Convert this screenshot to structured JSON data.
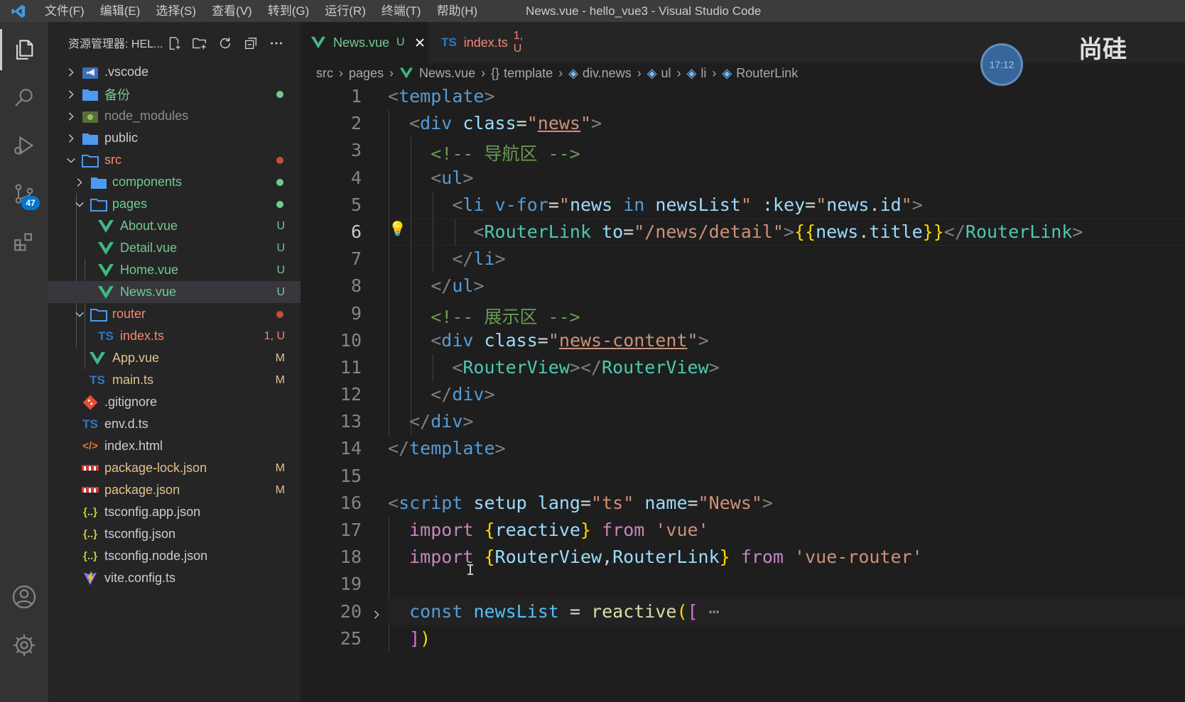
{
  "app": {
    "window_title": "News.vue - hello_vue3 - Visual Studio Code",
    "menu": [
      "文件(F)",
      "编辑(E)",
      "选择(S)",
      "查看(V)",
      "转到(G)",
      "运行(R)",
      "终端(T)",
      "帮助(H)"
    ]
  },
  "activity_bar": {
    "source_control_badge": "47"
  },
  "explorer": {
    "title": "资源管理器: HEL...",
    "items": [
      {
        "name": ".vscode",
        "type": "folder",
        "status": ""
      },
      {
        "name": "备份",
        "type": "folder",
        "status": ""
      },
      {
        "name": "node_modules",
        "type": "folder",
        "status": ""
      },
      {
        "name": "public",
        "type": "folder",
        "status": ""
      },
      {
        "name": "src",
        "type": "folder",
        "status": ""
      },
      {
        "name": "components",
        "type": "folder",
        "status": ""
      },
      {
        "name": "pages",
        "type": "folder",
        "status": ""
      },
      {
        "name": "About.vue",
        "type": "vue",
        "status": "U"
      },
      {
        "name": "Detail.vue",
        "type": "vue",
        "status": "U"
      },
      {
        "name": "Home.vue",
        "type": "vue",
        "status": "U"
      },
      {
        "name": "News.vue",
        "type": "vue",
        "status": "U"
      },
      {
        "name": "router",
        "type": "folder",
        "status": ""
      },
      {
        "name": "index.ts",
        "type": "ts",
        "status": "1, U"
      },
      {
        "name": "App.vue",
        "type": "vue",
        "status": "M"
      },
      {
        "name": "main.ts",
        "type": "ts",
        "status": "M"
      },
      {
        "name": ".gitignore",
        "type": "git",
        "status": ""
      },
      {
        "name": "env.d.ts",
        "type": "ts",
        "status": ""
      },
      {
        "name": "index.html",
        "type": "html",
        "status": ""
      },
      {
        "name": "package-lock.json",
        "type": "npm",
        "status": "M"
      },
      {
        "name": "package.json",
        "type": "npm",
        "status": "M"
      },
      {
        "name": "tsconfig.app.json",
        "type": "json",
        "status": ""
      },
      {
        "name": "tsconfig.json",
        "type": "json",
        "status": ""
      },
      {
        "name": "tsconfig.node.json",
        "type": "json",
        "status": ""
      },
      {
        "name": "vite.config.ts",
        "type": "vite",
        "status": ""
      }
    ]
  },
  "tabs": [
    {
      "label": "News.vue",
      "status": "U",
      "icon": "V"
    },
    {
      "label": "index.ts",
      "status": "1, U",
      "icon": "TS"
    }
  ],
  "breadcrumb": [
    "src",
    "pages",
    "News.vue",
    "template",
    "div.news",
    "ul",
    "li",
    "RouterLink"
  ],
  "line_numbers": [
    "1",
    "2",
    "3",
    "4",
    "5",
    "6",
    "7",
    "8",
    "9",
    "10",
    "11",
    "12",
    "13",
    "14",
    "15",
    "16",
    "17",
    "18",
    "19",
    "20",
    "25"
  ],
  "overlay": {
    "clock": "17:12",
    "corner_text": "尚硅"
  },
  "colors": {
    "accent": "#0078d4",
    "untracked": "#73c991",
    "modified": "#e2c08d",
    "error": "#f48771"
  }
}
